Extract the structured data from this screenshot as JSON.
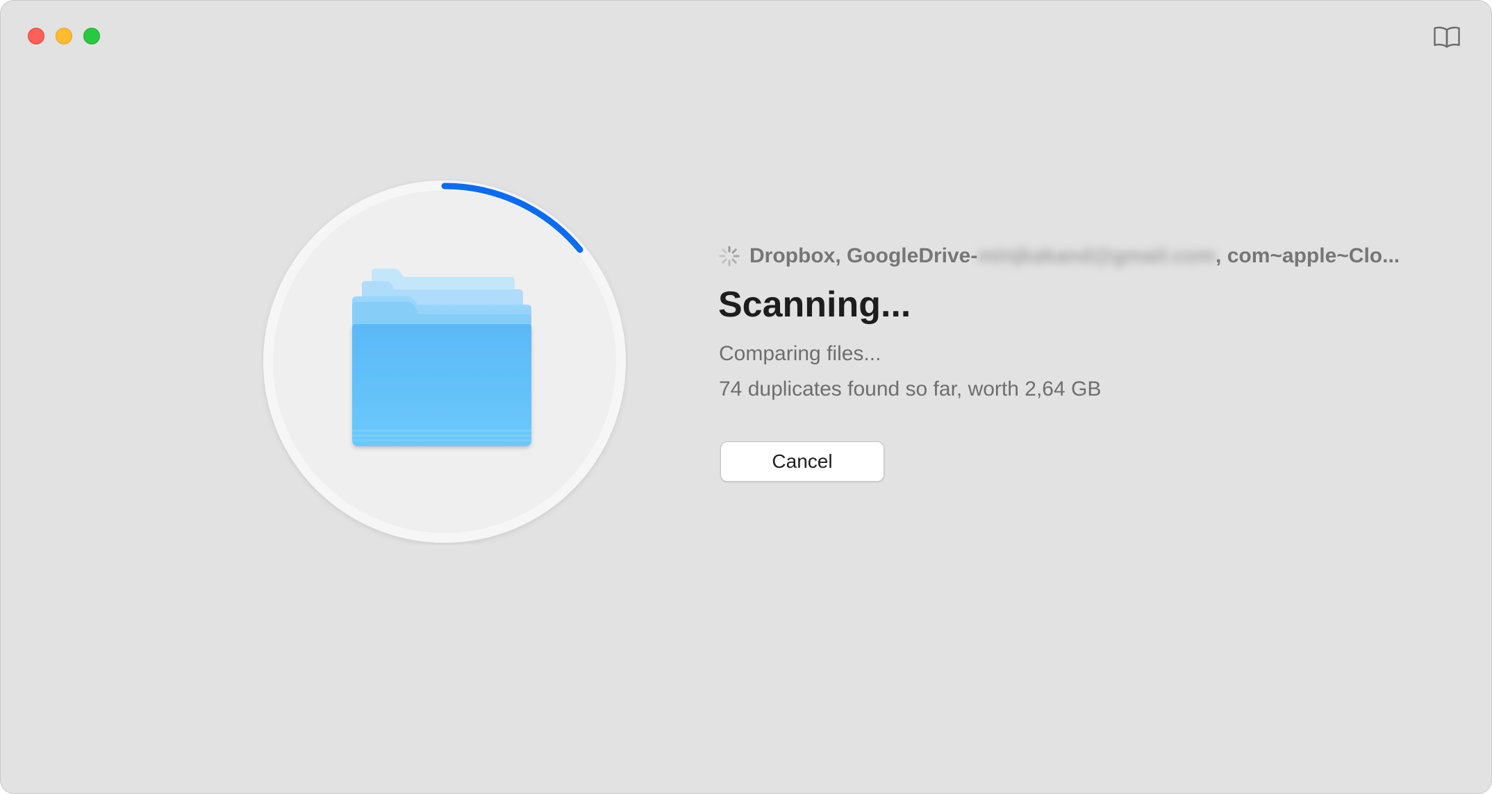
{
  "window": {
    "controls": {
      "close_color": "#fe5f57",
      "minimize_color": "#febc2e",
      "zoom_color": "#28c840"
    },
    "toolbar_icon": "book-icon"
  },
  "scan": {
    "progress_fraction": 0.14,
    "accent_color": "#0a6cf5",
    "locations_prefix": "Dropbox, GoogleDrive-",
    "locations_blurred": "minjkakand@gmail.com",
    "locations_suffix": ", com~apple~Clo...",
    "title": "Scanning...",
    "status": "Comparing files...",
    "summary": "74 duplicates found so far, worth 2,64 GB",
    "cancel_label": "Cancel"
  }
}
